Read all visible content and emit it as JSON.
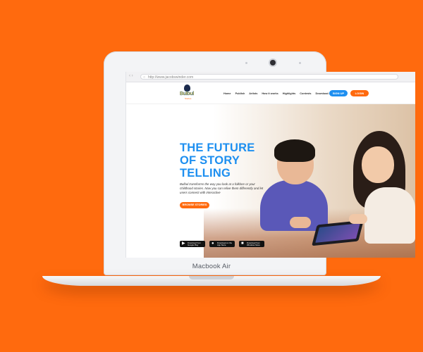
{
  "browser": {
    "url": "http://www.jacobswinder.com"
  },
  "site": {
    "logo_text": "Bulbul",
    "logo_sub": "Stories",
    "nav": [
      "Home",
      "Publish",
      "Artists",
      "How it works",
      "Highlights",
      "Contests",
      "Download App",
      "Press"
    ],
    "signup_label": "SIGN UP",
    "login_label": "LOGIN"
  },
  "hero": {
    "title_lines": [
      "THE FUTURE",
      "OF STORY",
      "TELLING"
    ],
    "description": "Bulbul transforms the way you look at a folklore or your childhood stories. Now you can relive them differently and let users connect with interactive",
    "browse_label": "BROWSE STORIES",
    "badges": [
      {
        "small": "Download from",
        "big": "Google Play",
        "icon": "play-store-icon"
      },
      {
        "small": "Download on the",
        "big": "App Store",
        "icon": "apple-icon"
      },
      {
        "small": "Download from",
        "big": "Windows Store",
        "icon": "windows-icon"
      }
    ]
  },
  "device": {
    "model": "Macbook Air"
  },
  "colors": {
    "background": "#ff6a0e",
    "accent_blue": "#1d8ff0",
    "accent_orange": "#ff6a0e"
  }
}
